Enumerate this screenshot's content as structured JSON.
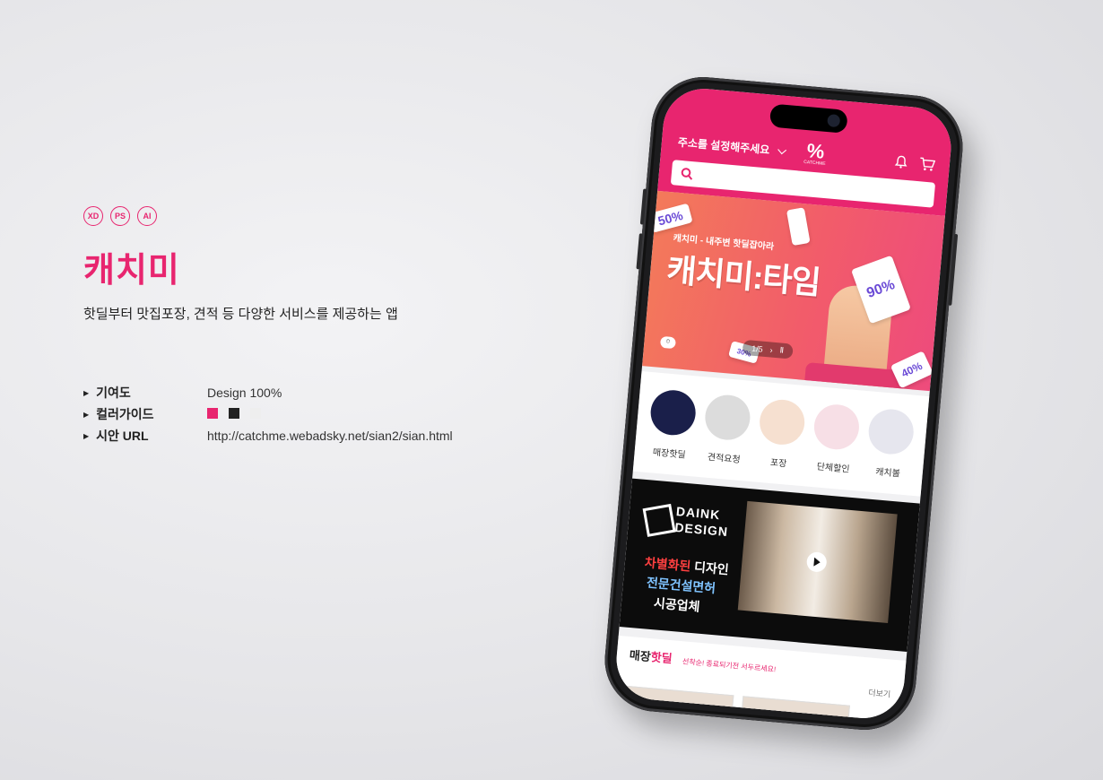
{
  "info": {
    "tools": [
      "XD",
      "PS",
      "AI"
    ],
    "title": "캐치미",
    "description": "핫딜부터 맛집포장, 견적 등 다양한 서비스를 제공하는 앱",
    "specs": {
      "contribution_key": "기여도",
      "contribution_val": "Design 100%",
      "color_key": "컬러가이드",
      "url_key": "시안 URL",
      "url_val": "http://catchme.webadsky.net/sian2/sian.html"
    },
    "colors": [
      "#e8256f",
      "#222222",
      "#eeeeee"
    ]
  },
  "app": {
    "address": "주소를 설정해주세요",
    "logo": "%",
    "logo_sub": "CATCHME",
    "banner": {
      "subtitle": "캐치미 - 내주변 핫딜잡아라",
      "title": "캐치미:타임",
      "tag1": "50%",
      "tag2": "90%",
      "tag3": "40%",
      "tag4": "30%",
      "pager": "1/5"
    },
    "categories": [
      {
        "label": "매장핫딜",
        "color": "#1a1f4a"
      },
      {
        "label": "견적요청",
        "color": "#dcdcdc"
      },
      {
        "label": "포장",
        "color": "#f6e0d0"
      },
      {
        "label": "단체할인",
        "color": "#f7dfe6"
      },
      {
        "label": "캐치볼",
        "color": "#e6e6ee"
      }
    ],
    "ad": {
      "brand1": "DAINK",
      "brand2": "DESIGN",
      "line1a": "차별화된",
      "line1b": " 디자인",
      "line2": "전문건설면허",
      "line3": "시공업체"
    },
    "deals": {
      "heading_a": "매장",
      "heading_b": "핫딜",
      "sub": "선착순! 종료되기전 서두르세요!",
      "more": "더보기"
    }
  }
}
